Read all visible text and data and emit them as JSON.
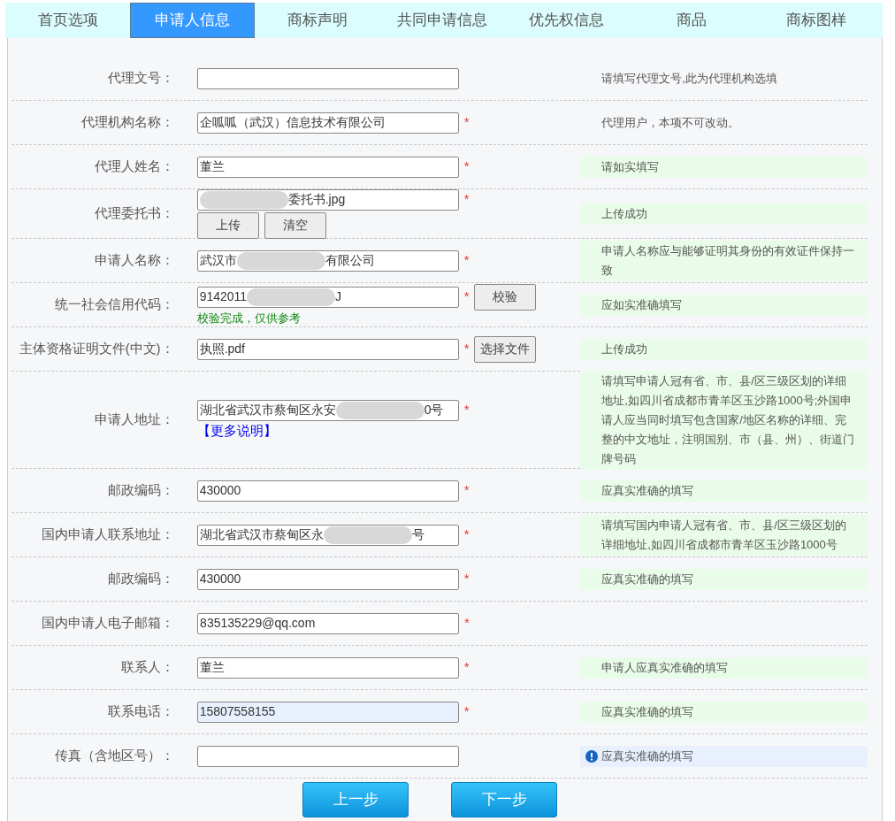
{
  "tabs": [
    {
      "label": "首页选项",
      "selected": false
    },
    {
      "label": "申请人信息",
      "selected": true
    },
    {
      "label": "商标声明",
      "selected": false
    },
    {
      "label": "共同申请信息",
      "selected": false
    },
    {
      "label": "优先权信息",
      "selected": false
    },
    {
      "label": "商品",
      "selected": false
    },
    {
      "label": "商标图样",
      "selected": false
    }
  ],
  "rows": [
    {
      "label": "代理文号：",
      "highlighted": false,
      "value": [],
      "hint": {
        "kind": "plain",
        "text": "请填写代理文号,此为代理机构选填"
      }
    },
    {
      "label": "代理机构名称：",
      "required_mark": "*",
      "highlighted": false,
      "value": [
        {
          "kind": "text",
          "text": "企呱呱（武汉）信息技术有限公司"
        }
      ],
      "hint": {
        "kind": "plain",
        "text": "代理用户，本项不可改动。"
      }
    },
    {
      "label": "代理人姓名：",
      "required_mark": "*",
      "highlighted": false,
      "value": [
        {
          "kind": "text",
          "text": "董兰"
        }
      ],
      "hint": {
        "kind": "ok",
        "text": "请如实填写"
      }
    },
    {
      "label": "代理委托书：",
      "required_mark": "*",
      "highlighted": false,
      "value": [
        {
          "kind": "blur"
        },
        {
          "kind": "text",
          "text": "委托书.jpg"
        }
      ],
      "buttons": [
        "上传",
        "清空"
      ],
      "hint": {
        "kind": "ok",
        "text": "上传成功"
      }
    },
    {
      "label": "申请人名称：",
      "required_mark": "*",
      "highlighted": false,
      "value": [
        {
          "kind": "text",
          "text": "武汉市"
        },
        {
          "kind": "blur"
        },
        {
          "kind": "text",
          "text": "有限公司"
        }
      ],
      "hint": {
        "kind": "ok",
        "text": "申请人名称应与能够证明其身份的有效证件保持一致"
      }
    },
    {
      "label": "统一社会信用代码：",
      "required_mark": "*",
      "highlighted": false,
      "value": [
        {
          "kind": "text",
          "text": "9142011"
        },
        {
          "kind": "blur"
        },
        {
          "kind": "text",
          "text": "J"
        }
      ],
      "side_button": "校验",
      "note": "校验完成，仅供参考",
      "hint": {
        "kind": "ok",
        "text": "应如实准确填写"
      }
    },
    {
      "label": "主体资格证明文件(中文)：",
      "required_mark": "*",
      "highlighted": false,
      "value": [
        {
          "kind": "text",
          "text": "执照.pdf"
        }
      ],
      "side_button": "选择文件",
      "hint": {
        "kind": "ok",
        "text": "上传成功"
      }
    },
    {
      "label": "申请人地址：",
      "required_mark": "*",
      "highlighted": false,
      "value": [
        {
          "kind": "text",
          "text": "湖北省武汉市蔡甸区永安"
        },
        {
          "kind": "blur"
        },
        {
          "kind": "text",
          "text": "0号"
        }
      ],
      "link": "【更多说明】",
      "hint": {
        "kind": "ok",
        "text": "请填写申请人冠有省、市、县/区三级区划的详细地址,如四川省成都市青羊区玉沙路1000号;外国申请人应当同时填写包含国家/地区名称的详细、完整的中文地址，注明国别、市（县、州）、街道门牌号码"
      }
    },
    {
      "label": "邮政编码：",
      "required_mark": "*",
      "highlighted": false,
      "value": [
        {
          "kind": "text",
          "text": "430000"
        }
      ],
      "hint": {
        "kind": "ok",
        "text": "应真实准确的填写"
      }
    },
    {
      "label": "国内申请人联系地址：",
      "required_mark": "*",
      "highlighted": false,
      "value": [
        {
          "kind": "text",
          "text": "湖北省武汉市蔡甸区永"
        },
        {
          "kind": "blur"
        },
        {
          "kind": "text",
          "text": "号"
        }
      ],
      "hint": {
        "kind": "ok",
        "text": "请填写国内申请人冠有省、市、县/区三级区划的详细地址,如四川省成都市青羊区玉沙路1000号"
      }
    },
    {
      "label": "邮政编码：",
      "required_mark": "*",
      "highlighted": false,
      "value": [
        {
          "kind": "text",
          "text": "430000"
        }
      ],
      "hint": {
        "kind": "ok",
        "text": "应真实准确的填写"
      }
    },
    {
      "label": "国内申请人电子邮箱：",
      "required_mark": "*",
      "highlighted": false,
      "value": [
        {
          "kind": "text",
          "text": "835135229@qq.com"
        }
      ]
    },
    {
      "label": "联系人：",
      "required_mark": "*",
      "highlighted": false,
      "value": [
        {
          "kind": "text",
          "text": "董兰"
        }
      ],
      "hint": {
        "kind": "ok",
        "text": "申请人应真实准确的填写"
      }
    },
    {
      "label": "联系电话：",
      "required_mark": "*",
      "highlighted": true,
      "value": [
        {
          "kind": "text",
          "text": "15807558155"
        }
      ],
      "hint": {
        "kind": "ok",
        "text": "应真实准确的填写"
      }
    },
    {
      "label": "传真（含地区号）：",
      "highlighted": false,
      "value": [],
      "hint": {
        "kind": "warn",
        "text": "应真实准确的填写"
      }
    }
  ],
  "nav_buttons": [
    "上一步",
    "下一步"
  ]
}
